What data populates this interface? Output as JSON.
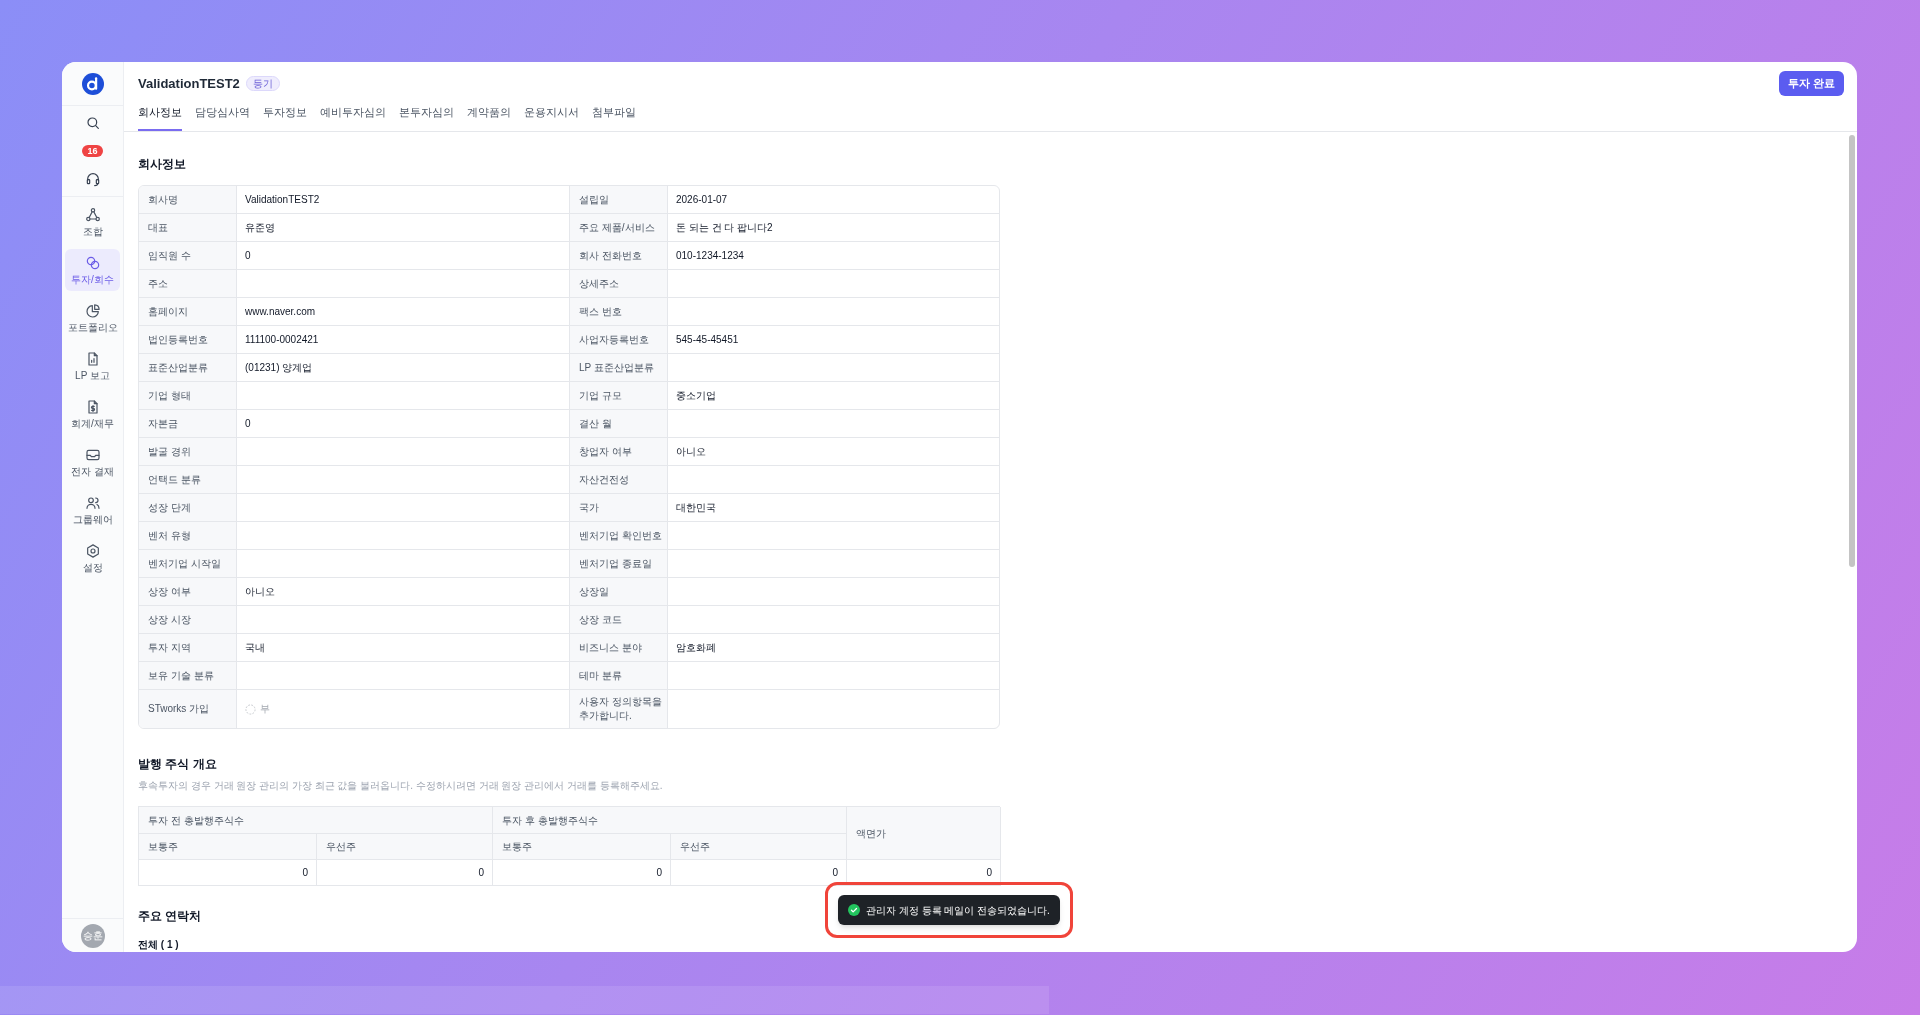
{
  "sidebar": {
    "badge": "16",
    "nav": [
      {
        "label": "조합",
        "selected": false
      },
      {
        "label": "투자/회수",
        "selected": true
      },
      {
        "label": "포트폴리오",
        "selected": false
      },
      {
        "label": "LP 보고",
        "selected": false
      },
      {
        "label": "회계/재무",
        "selected": false
      },
      {
        "label": "전자 결재",
        "selected": false
      },
      {
        "label": "그룹웨어",
        "selected": false
      },
      {
        "label": "설정",
        "selected": false
      }
    ],
    "avatar": "승훈"
  },
  "header": {
    "title": "ValidationTEST2",
    "badge": "등기",
    "action": "투자 완료"
  },
  "tabs": [
    {
      "label": "회사정보",
      "selected": true
    },
    {
      "label": "담당심사역",
      "selected": false
    },
    {
      "label": "투자정보",
      "selected": false
    },
    {
      "label": "예비투자심의",
      "selected": false
    },
    {
      "label": "본투자심의",
      "selected": false
    },
    {
      "label": "계약품의",
      "selected": false
    },
    {
      "label": "운용지시서",
      "selected": false
    },
    {
      "label": "첨부파일",
      "selected": false
    }
  ],
  "company_info": {
    "heading": "회사정보",
    "rows": [
      [
        {
          "label": "회사명",
          "kind": "text",
          "value": "ValidationTEST2"
        },
        {
          "label": "설립일",
          "kind": "text",
          "value": "2026-01-07"
        }
      ],
      [
        {
          "label": "대표",
          "kind": "text",
          "value": "유준영"
        },
        {
          "label": "주요 제품/서비스",
          "kind": "text",
          "value": "돈 되는 건 다 팝니다2"
        }
      ],
      [
        {
          "label": "임직원 수",
          "kind": "text",
          "value": "0"
        },
        {
          "label": "회사 전화번호",
          "kind": "text",
          "value": "010-1234-1234"
        }
      ],
      [
        {
          "label": "주소",
          "kind": "text"
        },
        {
          "label": "상세주소",
          "kind": "text"
        }
      ],
      [
        {
          "label": "홈페이지",
          "kind": "text",
          "value": "www.naver.com"
        },
        {
          "label": "팩스 번호",
          "kind": "text"
        }
      ],
      [
        {
          "label": "법인등록번호",
          "kind": "text",
          "value": "111100-0002421"
        },
        {
          "label": "사업자등록번호",
          "kind": "text",
          "value": "545-45-45451"
        }
      ],
      [
        {
          "label": "표준산업분류",
          "kind": "text",
          "value": "(01231) 양계업"
        },
        {
          "label": "LP 표준산업분류",
          "kind": "text"
        }
      ],
      [
        {
          "label": "기업 형태",
          "kind": "text"
        },
        {
          "label": "기업 규모",
          "kind": "text",
          "value": "중소기업"
        }
      ],
      [
        {
          "label": "자본금",
          "kind": "text",
          "value": "0"
        },
        {
          "label": "결산 월",
          "kind": "text"
        }
      ],
      [
        {
          "label": "발굴 경위",
          "kind": "text"
        },
        {
          "label": "창업자 여부",
          "kind": "text",
          "value": "아니오"
        }
      ],
      [
        {
          "label": "언택드 분류",
          "kind": "text"
        },
        {
          "label": "자산건전성",
          "kind": "text"
        }
      ],
      [
        {
          "label": "성장 단계",
          "kind": "text"
        },
        {
          "label": "국가",
          "kind": "text",
          "value": "대한민국"
        }
      ],
      [
        {
          "label": "벤처 유형",
          "kind": "text"
        },
        {
          "label": "벤처기업 확인번호",
          "kind": "text"
        }
      ],
      [
        {
          "label": "벤처기업 시작일",
          "kind": "text"
        },
        {
          "label": "벤처기업 종료일",
          "kind": "text"
        }
      ],
      [
        {
          "label": "상장 여부",
          "kind": "text",
          "value": "아니오"
        },
        {
          "label": "상장일",
          "kind": "text"
        }
      ],
      [
        {
          "label": "상장 시장",
          "kind": "text"
        },
        {
          "label": "상장 코드",
          "kind": "text"
        }
      ],
      [
        {
          "label": "투자 지역",
          "kind": "text",
          "value": "국내"
        },
        {
          "label": "비즈니스 분야",
          "kind": "text",
          "value": "암호화폐"
        }
      ],
      [
        {
          "label": "보유 기술 분류",
          "kind": "text"
        },
        {
          "label": "테마 분류",
          "kind": "text"
        }
      ],
      [
        {
          "label": "STworks 가입",
          "kind": "radio",
          "value": "부",
          "checked": false
        },
        {
          "label": "사용자 정의항목을 추가합니다.",
          "kind": "text"
        }
      ]
    ]
  },
  "shares": {
    "heading": "발행 주식 개요",
    "note": "후속투자의 경우 거래 원장 관리의 가장 최근 값을 불러옵니다. 수정하시려면 거래 원장 관리에서 거래를 등록해주세요.",
    "groups": [
      {
        "label": "투자 전 총발행주식수",
        "columns": [
          "보통주",
          "우선주"
        ]
      },
      {
        "label": "투자 후 총발행주식수",
        "columns": [
          "보통주",
          "우선주"
        ]
      }
    ],
    "par_value": "액면가",
    "values": [
      "0",
      "0",
      "0",
      "0",
      "0"
    ]
  },
  "contacts": {
    "heading": "주요 연락처",
    "count": "전체 ( 1 )"
  },
  "toast": {
    "message": "관리자 계정 등록 메일이 전송되었습니다.",
    "highlighted": true
  }
}
